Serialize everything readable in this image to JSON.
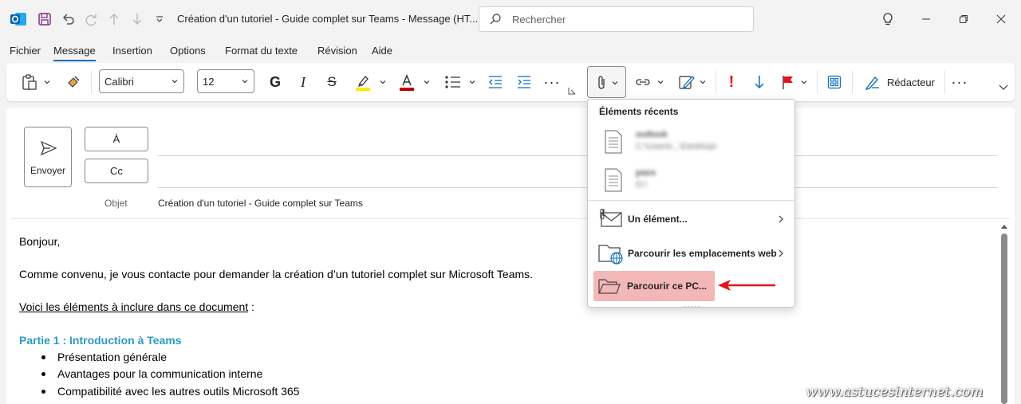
{
  "titlebar": {
    "title": "Création d'un tutoriel - Guide complet sur Teams  -  Message (HT...",
    "search_placeholder": "Rechercher"
  },
  "menu": {
    "tabs": [
      "Fichier",
      "Message",
      "Insertion",
      "Options",
      "Format du texte",
      "Révision",
      "Aide"
    ],
    "active": "Message"
  },
  "ribbon": {
    "font_name": "Calibri",
    "font_size": "12",
    "redacteur_label": "Rédacteur",
    "font_color": "#c00000",
    "highlight_color": "#ffe600"
  },
  "compose": {
    "send_label": "Envoyer",
    "to_label": "À",
    "cc_label": "Cc",
    "subject_label": "Objet",
    "subject_value": "Création d'un tutoriel - Guide complet sur Teams"
  },
  "body": {
    "greeting": "Bonjour,",
    "para1": "Comme convenu, je vous contacte pour demander la création d’un tutoriel complet sur Microsoft Teams.",
    "list_intro": "Voici les éléments à inclure dans ce document",
    "list_intro_suffix": " :",
    "section1_title": "Partie 1 : Introduction à Teams",
    "bullets": [
      "Présentation générale",
      "Avantages pour la communication interne",
      "Compatibilité avec les autres outils Microsoft 365"
    ]
  },
  "attach_menu": {
    "title": "Éléments récents",
    "recent": [
      {
        "name": "outlook",
        "path": "C:\\Users\\...\\Desktop\\"
      },
      {
        "name": "pass",
        "path": "D:\\"
      }
    ],
    "item_element": "Un élément...",
    "item_web": "Parcourir les emplacements web",
    "item_pc": "Parcourir ce PC...",
    "highlight_color": "#f4b7b7",
    "arrow_color": "#e0161b"
  },
  "watermark": "www.astucesinternet.com"
}
